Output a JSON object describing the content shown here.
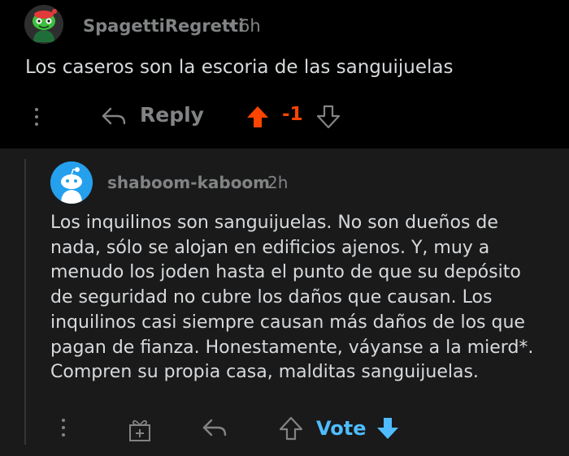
{
  "parent_comment": {
    "username": "SpagettiRegretti",
    "separator": "•",
    "time": "6h",
    "body": "Los caseros son la escoria de las sanguijuelas",
    "actions": {
      "reply_label": "Reply",
      "score": "-1",
      "upvote_color": "#ff4500",
      "score_color": "#ff4500"
    }
  },
  "reply_comment": {
    "username": "shaboom-kaboom",
    "time": "2h",
    "body_lines": [
      "Los inquilinos son sanguijuelas. No son dueños de",
      "nada, sólo se alojan en edificios ajenos. Y, muy a",
      "menudo los joden hasta el punto de que su depósito",
      "de seguridad no cubre los daños que causan. Los",
      "inquilinos casi siempre causan más daños de los que",
      "pagan de fianza. Honestamente, váyanse a la mierd*.",
      "Compren su propia casa, malditas sanguijuelas."
    ],
    "actions": {
      "vote_label": "Vote",
      "vote_color": "#4fbcff"
    }
  },
  "icons": {
    "avatar1": "snoo-avatar-green-icon",
    "avatar2": "snoo-avatar-default-icon",
    "more": "kebab-menu-icon",
    "reply": "reply-arrow-icon",
    "upvote": "upvote-arrow-icon",
    "downvote": "downvote-arrow-icon",
    "award": "award-gift-icon"
  }
}
